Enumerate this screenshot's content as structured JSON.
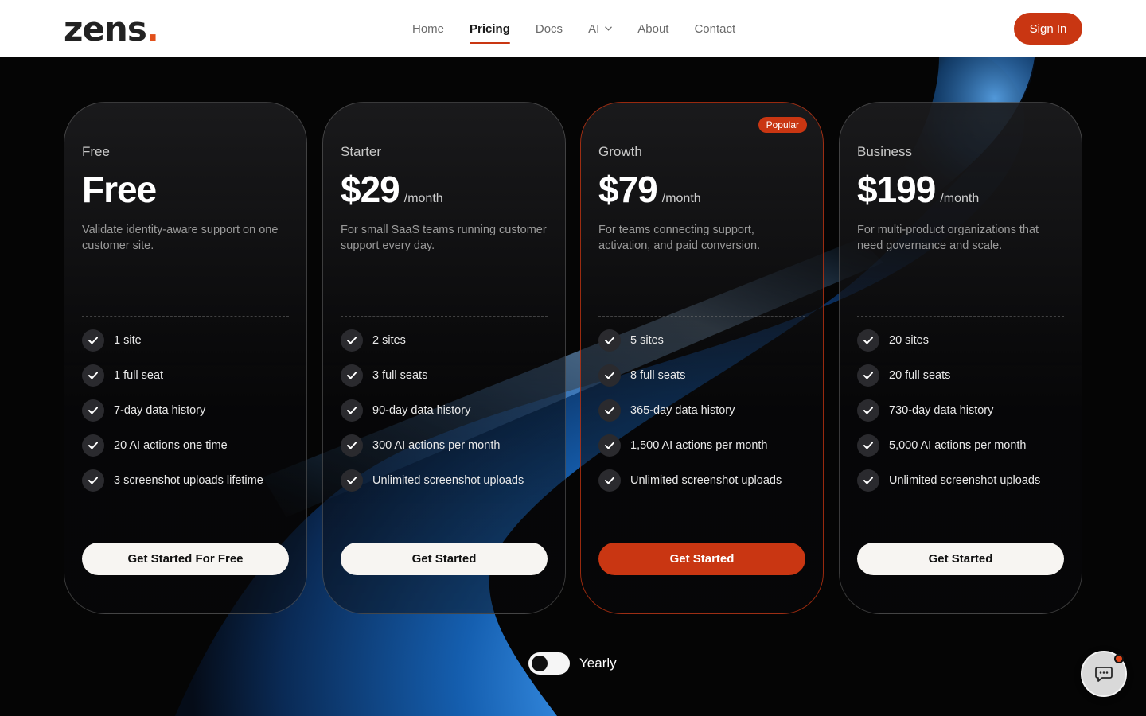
{
  "brand": {
    "name": "zens",
    "dot": ".",
    "accent": "#c93612"
  },
  "nav": {
    "items": [
      {
        "label": "Home",
        "active": false
      },
      {
        "label": "Pricing",
        "active": true
      },
      {
        "label": "Docs",
        "active": false
      },
      {
        "label": "AI",
        "active": false,
        "has_dropdown": true
      },
      {
        "label": "About",
        "active": false
      },
      {
        "label": "Contact",
        "active": false
      }
    ],
    "signin_label": "Sign In"
  },
  "plans": [
    {
      "name": "Free",
      "price": "Free",
      "period": "",
      "description": "Validate identity-aware support on one customer site.",
      "features": [
        "1 site",
        "1 full seat",
        "7-day data history",
        "20 AI actions one time",
        "3 screenshot uploads lifetime"
      ],
      "cta": "Get Started For Free",
      "popular": false
    },
    {
      "name": "Starter",
      "price": "$29",
      "period": "/month",
      "description": "For small SaaS teams running customer support every day.",
      "features": [
        "2 sites",
        "3 full seats",
        "90-day data history",
        "300 AI actions per month",
        "Unlimited screenshot uploads"
      ],
      "cta": "Get Started",
      "popular": false
    },
    {
      "name": "Growth",
      "price": "$79",
      "period": "/month",
      "description": "For teams connecting support, activation, and paid conversion.",
      "features": [
        "5 sites",
        "8 full seats",
        "365-day data history",
        "1,500 AI actions per month",
        "Unlimited screenshot uploads"
      ],
      "cta": "Get Started",
      "popular": true,
      "badge": "Popular"
    },
    {
      "name": "Business",
      "price": "$199",
      "period": "/month",
      "description": "For multi-product organizations that need governance and scale.",
      "features": [
        "20 sites",
        "20 full seats",
        "730-day data history",
        "5,000 AI actions per month",
        "Unlimited screenshot uploads"
      ],
      "cta": "Get Started",
      "popular": false
    }
  ],
  "billing_toggle": {
    "label": "Yearly",
    "on": false
  },
  "chat": {
    "icon": "chat-bubble-icon",
    "has_notification": true
  }
}
